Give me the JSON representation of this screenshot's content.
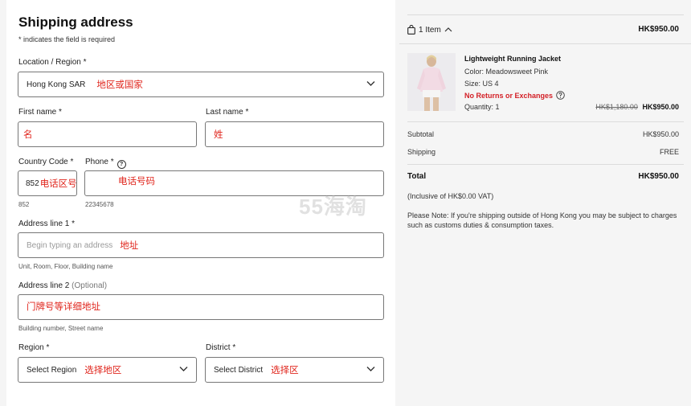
{
  "form": {
    "title": "Shipping address",
    "required_note": "* indicates the field is required",
    "location": {
      "label": "Location / Region *",
      "value": "Hong Kong SAR",
      "note": "地区或国家"
    },
    "first_name": {
      "label": "First name *",
      "note": "名"
    },
    "last_name": {
      "label": "Last name *",
      "note": "姓"
    },
    "country_code": {
      "label": "Country Code *",
      "value": "852",
      "note": "电话区号",
      "hint": "852"
    },
    "phone": {
      "label": "Phone *",
      "note": "电话号码",
      "hint": "22345678",
      "help_glyph": "?"
    },
    "address1": {
      "label": "Address line 1 *",
      "placeholder": "Begin typing an address",
      "note": "地址",
      "hint": "Unit, Room, Floor, Building name"
    },
    "address2": {
      "label": "Address line 2",
      "optional": "(Optional)",
      "note": "门牌号等详细地址",
      "hint": "Building number, Street name"
    },
    "region": {
      "label": "Region *",
      "value": "Select Region",
      "note": "选择地区"
    },
    "district": {
      "label": "District *",
      "value": "Select District",
      "note": "选择区"
    }
  },
  "summary": {
    "items_toggle": "1 Item",
    "header_total": "HK$950.00",
    "product": {
      "name": "Lightweight Running Jacket",
      "color": "Color: Meadowsweet Pink",
      "size": "Size: US 4",
      "returns": "No Returns or Exchanges",
      "quantity": "Quantity: 1",
      "original_price": "HK$1,180.00",
      "price": "HK$950.00"
    },
    "subtotal_label": "Subtotal",
    "subtotal_value": "HK$950.00",
    "shipping_label": "Shipping",
    "shipping_value": "FREE",
    "total_label": "Total",
    "total_value": "HK$950.00",
    "vat_note": "(Inclusive of HK$0.00 VAT)",
    "please_note": "Please Note: If you're shipping outside of Hong Kong you may be subject to charges such as customs duties & consumption taxes."
  },
  "watermark": "55海淘",
  "colors": {
    "annotation_red": "#e0261d",
    "returns_red": "#d31f26"
  },
  "icons": [
    "chevron-down-icon",
    "help-circle-icon",
    "shopping-bag-icon",
    "chevron-up-icon"
  ]
}
